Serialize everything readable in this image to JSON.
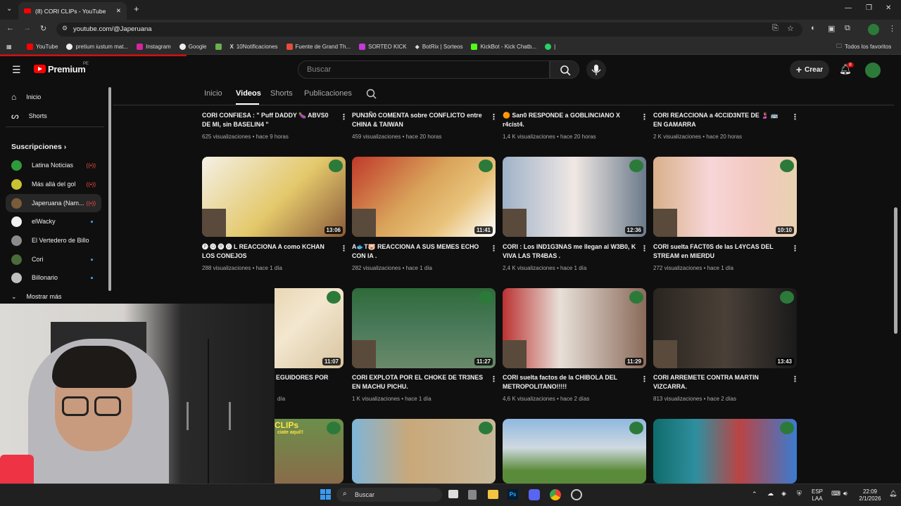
{
  "browser": {
    "tab_title": "(8) CORI CLIPs - YouTube",
    "url": "youtube.com/@Japeruana",
    "bookmarks": [
      "YouTube",
      "pretium iustum mat...",
      "Instagram",
      "Google",
      "",
      "10Notificaciones",
      "Fuente de Grand Th...",
      "SORTEO KICK",
      "BotRix | Sorteos",
      "KickBot - Kick Chatb...",
      "|"
    ],
    "all_bookmarks": "Todos los favoritos"
  },
  "header": {
    "logo": "Premium",
    "region": "PE",
    "search_placeholder": "Buscar",
    "create_label": "Crear",
    "notif_count": "8"
  },
  "sidebar": {
    "home": "Inicio",
    "shorts": "Shorts",
    "subs_title": "Suscripciones",
    "channels": [
      {
        "name": "Latina Noticias",
        "color": "#2f9a3b",
        "status": "live"
      },
      {
        "name": "Más allá del gol",
        "color": "#c9c232",
        "status": "live"
      },
      {
        "name": "Japeruana (Nam...",
        "color": "#7a5c3a",
        "status": "live"
      },
      {
        "name": "elWacky",
        "color": "#f1f1f1",
        "status": "new"
      },
      {
        "name": "El Vertedero de Billo",
        "color": "#8b8b8b",
        "status": ""
      },
      {
        "name": "Cori",
        "color": "#4a6b3a",
        "status": "new"
      },
      {
        "name": "Billonario",
        "color": "#c0c0c0",
        "status": "new"
      }
    ],
    "more": "Mostrar más"
  },
  "channel_tabs": [
    "Inicio",
    "Videos",
    "Shorts",
    "Publicaciones"
  ],
  "rows": [
    [
      {
        "title": "CORI CONFIESA : \" Puff DADDY 🍆 ABVS0 DE MI, sin BASELIN4 \"",
        "views": "625 visualizaciones",
        "age": "hace 9 horas"
      },
      {
        "title": "PUN3Ñ0 COMENTA sobre CONFLICTO entre CHINA & TAIWAN",
        "views": "459 visualizaciones",
        "age": "hace 20 horas"
      },
      {
        "title": "🟠 San0 RESPONDE a GOBLINCIANO X r4cist4.",
        "views": "1,4 K visualizaciones",
        "age": "hace 20 horas"
      },
      {
        "title": "CORI REACCIONA a 4CCID3NTE DE 🤰 🚌 EN GAMARRA",
        "views": "2 K visualizaciones",
        "age": "hace 20 horas"
      }
    ],
    [
      {
        "title": "🅟 🅞 🅡 🅞 L REACCIONA A como KCHAN LOS CONEJOS",
        "views": "288 visualizaciones",
        "age": "hace 1 día",
        "duration": "13:06"
      },
      {
        "title": "A🐟T🐷 REACCIONA A SUS MEMES ECHO CON IA .",
        "views": "282 visualizaciones",
        "age": "hace 1 día",
        "duration": "11:41"
      },
      {
        "title": "CORI : Los IND1G3NAS me llegan al W3B0, K VIVA LAS TR4BAS .",
        "views": "2,4 K visualizaciones",
        "age": "hace 1 día",
        "duration": "12:36"
      },
      {
        "title": "CORI suelta FACT0S de las L4YCAS DEL STREAM en MIERDU",
        "views": "272 visualizaciones",
        "age": "hace 1 día",
        "duration": "10:10"
      }
    ],
    [
      {
        "title": "EGUIDORES POR",
        "views": "",
        "age": "día",
        "duration": "11:07"
      },
      {
        "title": "CORI EXPLOTA POR EL CHOKE DE TR3NES EN MACHU PICHU.",
        "views": "1 K visualizaciones",
        "age": "hace 1 día",
        "duration": "11:27"
      },
      {
        "title": "CORI suelta factos de la CHIBOLA DEL METROPOLITANO!!!!!",
        "views": "4,6 K visualizaciones",
        "age": "hace 2 días",
        "duration": "11:29"
      },
      {
        "title": "CORI ARREMETE CONTRA MARTIN VIZCARRA.",
        "views": "813 visualizaciones",
        "age": "hace 2 días",
        "duration": "13:43"
      }
    ]
  ],
  "bottom_thumb_text": [
    "CLIPs",
    "ciate aquí!!"
  ],
  "taskbar": {
    "search": "Buscar",
    "lang": "ESP",
    "lang2": "LAA",
    "time": "22:09",
    "date": "2/1/2026"
  },
  "colors": {
    "accent": "#ff0000",
    "bg": "#0f0f0f",
    "live": "#ff4e45",
    "newdot": "#3ea6ff"
  }
}
